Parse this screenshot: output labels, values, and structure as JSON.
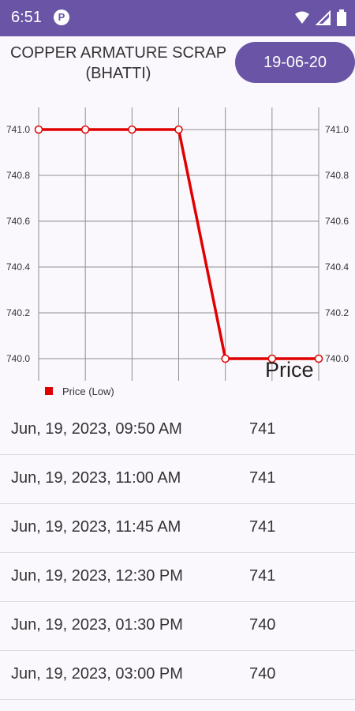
{
  "status_bar": {
    "time": "6:51",
    "app_icon_letter": "P"
  },
  "header": {
    "title": "COPPER ARMATURE SCRAP\n(BHATTI)",
    "title_line1": "COPPER ARMATURE SCRAP",
    "title_line2": "(BHATTI)",
    "date_button": "19-06-20"
  },
  "chart_data": {
    "type": "line",
    "x_count": 7,
    "series": [
      {
        "name": "Price (Low)",
        "color": "#e00000",
        "values": [
          741.0,
          741.0,
          741.0,
          741.0,
          740.0,
          740.0,
          740.0
        ]
      }
    ],
    "y_left_ticks": [
      "741.0",
      "740.8",
      "740.6",
      "740.4",
      "740.2",
      "740.0"
    ],
    "y_right_ticks": [
      "741.0",
      "740.8",
      "740.6",
      "740.4",
      "740.2",
      "740.0"
    ],
    "ylim": [
      740.0,
      741.0
    ],
    "grid": true,
    "overlay_label": "Price",
    "legend_position": "bottom-left"
  },
  "table": {
    "rows": [
      {
        "time": "Jun, 19, 2023, 09:50 AM",
        "price": "741"
      },
      {
        "time": "Jun, 19, 2023, 11:00 AM",
        "price": "741"
      },
      {
        "time": "Jun, 19, 2023, 11:45 AM",
        "price": "741"
      },
      {
        "time": "Jun, 19, 2023, 12:30 PM",
        "price": "741"
      },
      {
        "time": "Jun, 19, 2023, 01:30 PM",
        "price": "740"
      },
      {
        "time": "Jun, 19, 2023, 03:00 PM",
        "price": "740"
      }
    ]
  },
  "colors": {
    "accent": "#6a54a6",
    "series": "#e00000"
  }
}
